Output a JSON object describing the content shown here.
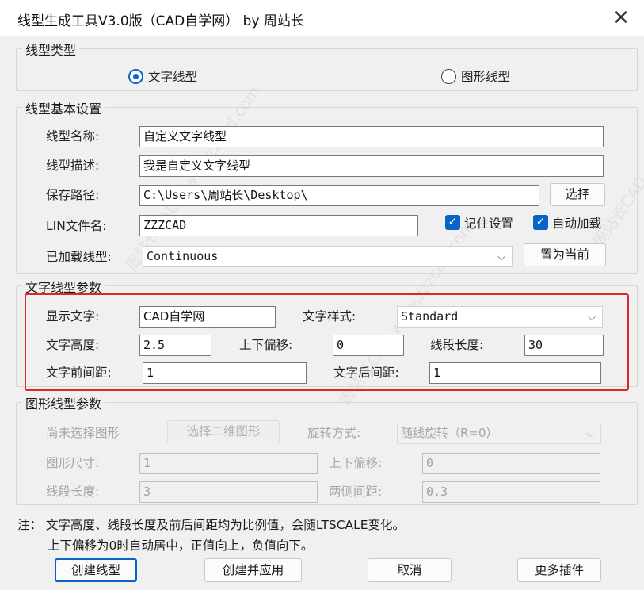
{
  "window": {
    "title": "线型生成工具V3.0版（CAD自学网） by 周站长",
    "close_icon": "close-icon"
  },
  "linetype_type": {
    "group_label": "线型类型",
    "option_text": "文字线型",
    "option_shape": "图形线型",
    "selected": "文字线型"
  },
  "basic": {
    "group_label": "线型基本设置",
    "name_label": "线型名称:",
    "name_value": "自定义文字线型",
    "desc_label": "线型描述:",
    "desc_value": "我是自定义文字线型",
    "path_label": "保存路径:",
    "path_value": "C:\\Users\\周站长\\Desktop\\",
    "browse_button": "选择",
    "lin_label": "LIN文件名:",
    "lin_value": "ZZZCAD",
    "remember_label": "记住设置",
    "remember_checked": true,
    "autoload_label": "自动加载",
    "autoload_checked": true,
    "loaded_label": "已加载线型:",
    "loaded_value": "Continuous",
    "set_current_button": "置为当前"
  },
  "text_params": {
    "group_label": "文字线型参数",
    "display_text_label": "显示文字:",
    "display_text_value": "CAD自学网",
    "text_style_label": "文字样式:",
    "text_style_value": "Standard",
    "text_height_label": "文字高度:",
    "text_height_value": "2.5",
    "offset_label": "上下偏移:",
    "offset_value": "0",
    "segment_label": "线段长度:",
    "segment_value": "30",
    "space_before_label": "文字前间距:",
    "space_before_value": "1",
    "space_after_label": "文字后间距:",
    "space_after_value": "1",
    "highlight_color": "#e0262a"
  },
  "shape_params": {
    "group_label": "图形线型参数",
    "no_shape_label": "尚未选择图形",
    "select_shape_button": "选择二维图形",
    "rotation_label": "旋转方式:",
    "rotation_value": "随线旋转（R=0）",
    "size_label": "图形尺寸:",
    "size_value": "1",
    "offset_label": "上下偏移:",
    "offset_value": "0",
    "segment_label": "线段长度:",
    "segment_value": "3",
    "gap_label": "两侧间距:",
    "gap_value": "0.3"
  },
  "notes": {
    "line1": "注：  文字高度、线段长度及前后间距均为比例值，会随LTSCALE变化。",
    "line2": "上下偏移为0时自动居中，正值向上，负值向下。"
  },
  "footer": {
    "create": "创建线型",
    "create_apply": "创建并应用",
    "cancel": "取消",
    "more_plugins": "更多插件"
  },
  "accent_color": "#0a64c8",
  "watermark": "周站长CAD  www.zzzcad.com"
}
